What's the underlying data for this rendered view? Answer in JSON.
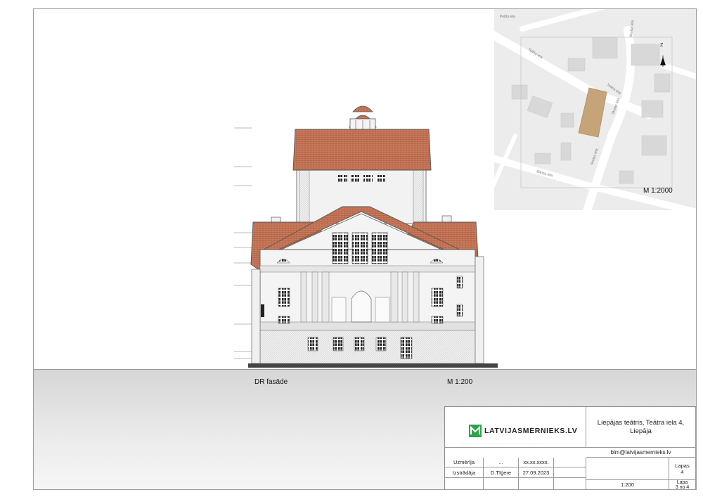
{
  "drawing": {
    "facade_label": "DR fasāde",
    "scale_label": "M 1:200"
  },
  "map": {
    "scale_label": "M 1:2000",
    "north_label": "Z",
    "streets": [
      "Teātra iela",
      "Teātra iela",
      "Skolas iela",
      "Skolas iela",
      "Bāriņu iela",
      "Skolas iela",
      "Peldu iela"
    ]
  },
  "title_block": {
    "logo_text": "LATVIJASMERNIEKS.LV",
    "project": "Liepājas teātris, Teātra iela 4, Liepāja",
    "email": "bim@latvijasmernieks.lv",
    "rows": [
      {
        "role": "Uzmērīja",
        "name": "...",
        "date": "xx.xx.xxxx."
      },
      {
        "role": "Izstrādāja",
        "name": "D.Tīģere",
        "date": "27.09.2023"
      }
    ],
    "sheet_label": "Lapas",
    "sheet_count": "4",
    "page_label": "Lapa",
    "page_value": "3 no 4",
    "scale": "1:200"
  },
  "colors": {
    "roof": "#c97a5c",
    "building_block": "#c6a47a",
    "logo_green": "#2ea34a"
  }
}
